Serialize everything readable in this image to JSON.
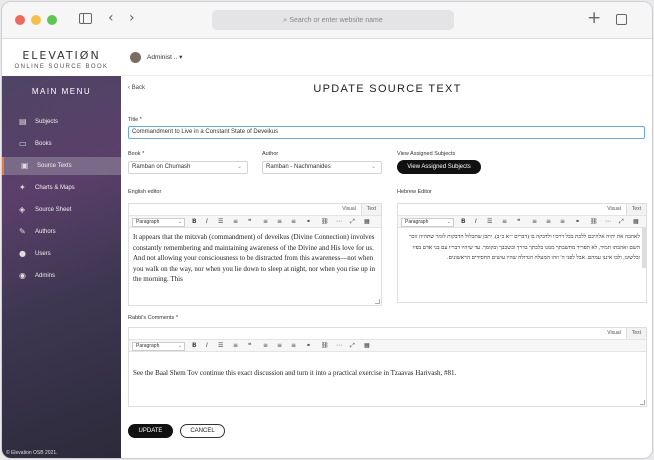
{
  "browser": {
    "url_placeholder": "Search or enter website name",
    "colors": {
      "close": "#ed6a5e",
      "minimize": "#f5bf4f",
      "maximize": "#61c554"
    }
  },
  "brand": {
    "name": "ELEVATIØN",
    "subtitle": "ONLINE SOURCE BOOK"
  },
  "sidebar": {
    "heading": "MAIN MENU",
    "items": [
      {
        "label": "Subjects",
        "icon": "book-open-icon",
        "glyph": "▤"
      },
      {
        "label": "Books",
        "icon": "book-icon",
        "glyph": "▭"
      },
      {
        "label": "Source Texts",
        "icon": "document-icon",
        "glyph": "▣",
        "active": true
      },
      {
        "label": "Charts & Maps",
        "icon": "chart-icon",
        "glyph": "✦"
      },
      {
        "label": "Source Sheet",
        "icon": "layers-icon",
        "glyph": "◈"
      },
      {
        "label": "Authors",
        "icon": "pen-icon",
        "glyph": "✎"
      },
      {
        "label": "Users",
        "icon": "user-icon",
        "glyph": "●"
      },
      {
        "label": "Admins",
        "icon": "admin-user-icon",
        "glyph": "◉"
      }
    ],
    "footer": "© Elevation OSB 2021."
  },
  "topbar": {
    "user": "Administ ..",
    "caret": "▾"
  },
  "page": {
    "back": "Back",
    "title": "UPDATE SOURCE TEXT"
  },
  "form": {
    "title_label": "Title *",
    "title_value": "Commandment to Live in a Constant State of Deveikus",
    "book_label": "Book *",
    "book_value": "Ramban on Chumash",
    "author_label": "Author",
    "author_value": "Ramban - Nachmanides",
    "assigned_label": "View Assigned Subjects",
    "assigned_button": "View Assigned Subjects",
    "english_label": "English editor",
    "hebrew_label": "Hebrew Editor",
    "comments_label": "Rabbi's Comments *",
    "visual_tab": "Visual",
    "text_tab": "Text",
    "paragraph": "Paragraph",
    "english_body": "It appears that the mitzvah (commandment) of deveikus (Divine Connection) involves constantly remembering and maintaining awareness of the Divine and His love for us. And not allowing your consciousness to be distracted from this awareness—not when you walk on the way, nor when you lie down to sleep at night, nor when you rise up in the morning. This",
    "hebrew_body": "לאהבה את יהוה אלהיכם ללכת בכל דרכיו ולדבקה בו (דברים י״א כ״ב). יתכן שתכלול הדבקות לומר שתהיה זוכר השם ואהבתו תמיד, לא תפריד מחשבתך ממנו בלכתך בדרך ובשכבך ובקומך. עד שיהיו דבריו עם בני אדם בפיו ובלשונו, ולבו איננו עמהם. אבל לפני ה' וזהו המעלה הגדולה שהיו עושים החסידים הראשונים.",
    "comments_body": "See the Baal Shem Tov continue this exact discussion and turn it into a practical exercise in Tzaavas Harivash, #81.",
    "update_button": "UPDATE",
    "cancel_button": "CANCEL"
  }
}
